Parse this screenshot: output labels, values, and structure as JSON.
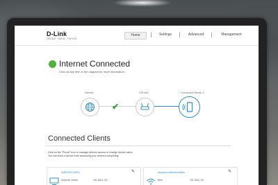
{
  "header": {
    "logo": "D-Link",
    "model": "DIR-842 · HW:A1 · FW:1.00",
    "nav": [
      {
        "label": "Home",
        "active": true
      },
      {
        "label": "Settings",
        "active": false
      },
      {
        "label": "Advanced",
        "active": false
      },
      {
        "label": "Management",
        "active": false
      }
    ]
  },
  "status": {
    "title": "Internet Connected",
    "subtitle": "Click on any item in the diagram for more information.",
    "color": "#4fb23a"
  },
  "diagram": {
    "nodes": [
      {
        "label": "Internet",
        "icon": "globe-icon"
      },
      {
        "label": "DIR-842",
        "icon": "router-icon"
      },
      {
        "label": "Connected Clients: 2",
        "icon": "device-icon"
      }
    ],
    "accent": "#2b8fd0"
  },
  "clients": {
    "title": "Connected Clients",
    "desc_line1": "Click on the \"Pencil\" icon to manage devices access or change device name.",
    "desc_line2": "You can block a device from accessing your network completely.",
    "cards": [
      {
        "name": "INBOOPC24876",
        "type": "Unknown Vendor",
        "ip": "192.168.0.100",
        "icon": "desktop-icon"
      },
      {
        "name": "android-cc5bd4eb4b56a",
        "type": "Beta",
        "ip": "192.168.0.101",
        "icon": "wifi-icon"
      }
    ]
  }
}
